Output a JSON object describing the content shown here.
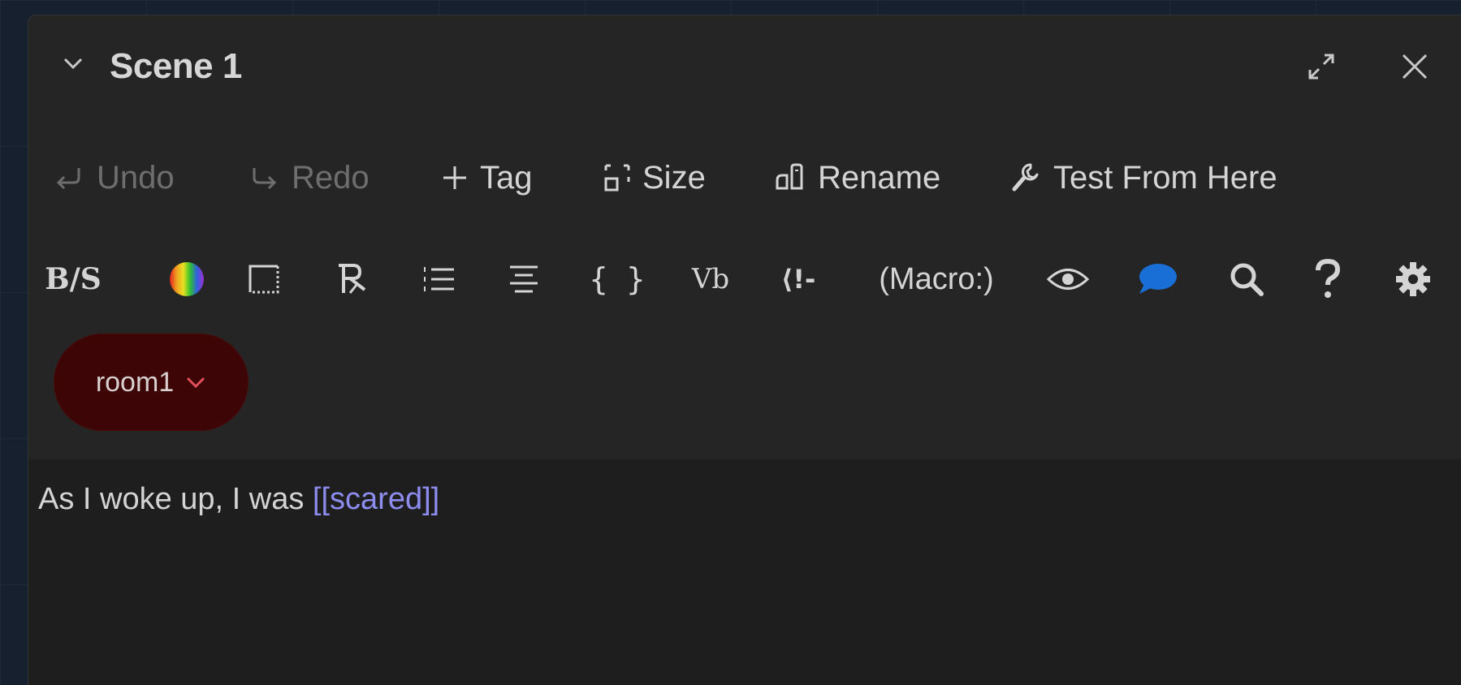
{
  "dialog": {
    "title": "Scene 1",
    "collapse_icon": "chevron-down-icon",
    "maximize_icon": "maximize-icon",
    "close_icon": "close-icon"
  },
  "toolbar": {
    "undo_label": "Undo",
    "redo_label": "Redo",
    "tag_label": "Tag",
    "size_label": "Size",
    "rename_label": "Rename",
    "test_label": "Test From Here"
  },
  "format_toolbar": {
    "bold_strike_glyph": "B/S",
    "align_glyph": "≡",
    "braces_glyph": "{ }",
    "vb_glyph": "Vb",
    "comment_glyph": "⟨!-",
    "macro_label": "(Macro:)",
    "icons": [
      "bold-strike-icon",
      "color-icon",
      "border-icon",
      "hook-icon",
      "list-icon",
      "align-icon",
      "braces-icon",
      "variable-icon",
      "comment-icon",
      "macro-icon",
      "eye-icon",
      "speech-bubble-icon",
      "search-icon",
      "help-icon",
      "gear-icon"
    ]
  },
  "tags": {
    "items": [
      {
        "label": "room1",
        "color": "#3d0505",
        "chevron_color": "#e0505a"
      }
    ]
  },
  "passage": {
    "text_plain": "As I woke up, I was ",
    "link_text": "[[scared]]",
    "link_color": "#8d8df0"
  },
  "colors": {
    "dialog_bg": "#252525",
    "editor_bg": "#1e1e1e",
    "accent_blue": "#1a6fd6"
  }
}
